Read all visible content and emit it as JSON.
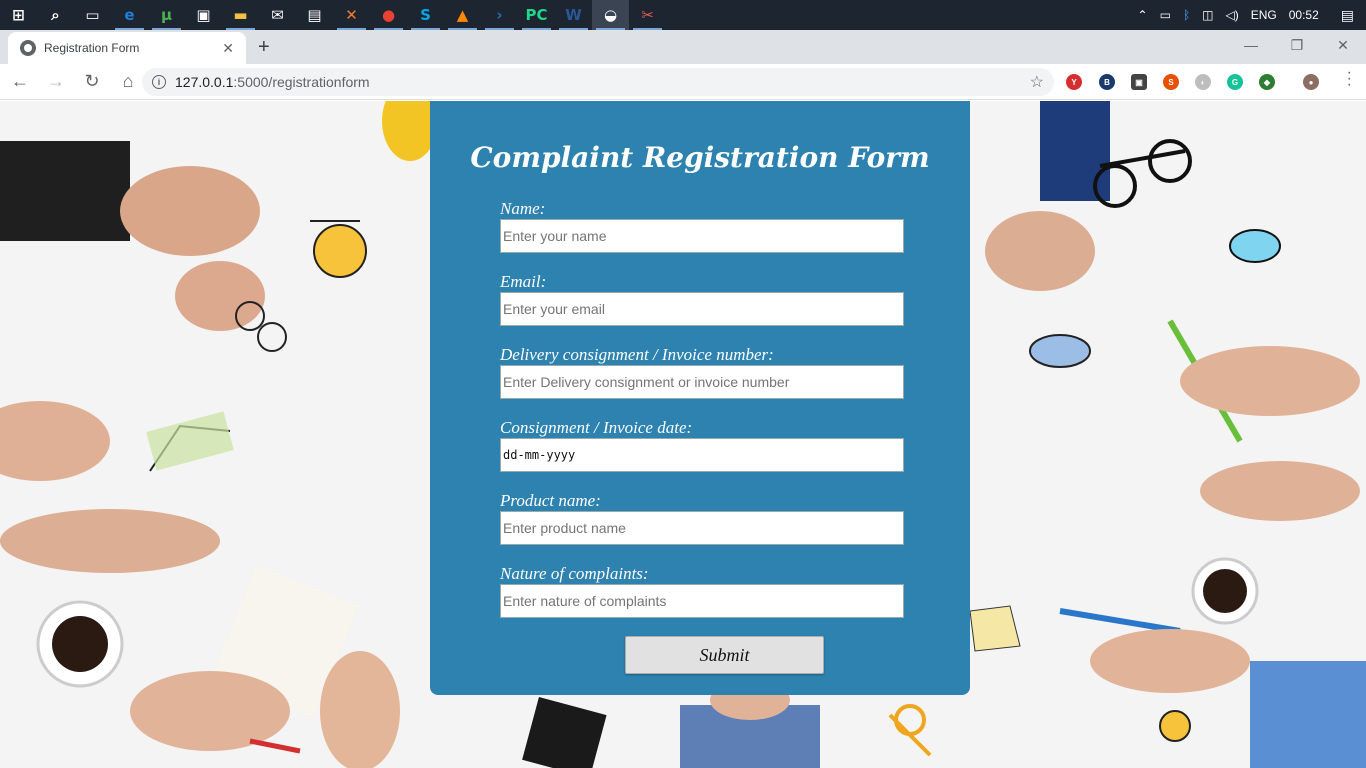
{
  "taskbar": {
    "apps": [
      {
        "name": "start-button",
        "glyph": "⊞",
        "color": "#ffffff"
      },
      {
        "name": "search-icon",
        "glyph": "⌕",
        "color": "#ffffff"
      },
      {
        "name": "task-view-icon",
        "glyph": "▭",
        "color": "#ffffff"
      },
      {
        "name": "edge-icon",
        "glyph": "e",
        "color": "#1e7ed8"
      },
      {
        "name": "utorrent-icon",
        "glyph": "µ",
        "color": "#4caf50"
      },
      {
        "name": "store-icon",
        "glyph": "▣",
        "color": "#ffffff"
      },
      {
        "name": "file-explorer-icon",
        "glyph": "▬",
        "color": "#f2c043"
      },
      {
        "name": "mail-icon",
        "glyph": "✉",
        "color": "#ffffff"
      },
      {
        "name": "notepad-icon",
        "glyph": "▤",
        "color": "#ffffff"
      },
      {
        "name": "xampp-icon",
        "glyph": "✕",
        "color": "#f57c2b"
      },
      {
        "name": "chrome-icon",
        "glyph": "●",
        "color": "#e94235"
      },
      {
        "name": "skype-icon",
        "glyph": "S",
        "color": "#00a6ed"
      },
      {
        "name": "vlc-icon",
        "glyph": "▲",
        "color": "#ff8800"
      },
      {
        "name": "powershell-icon",
        "glyph": "›",
        "color": "#2671be"
      },
      {
        "name": "pycharm-icon",
        "glyph": "PC",
        "color": "#21d789"
      },
      {
        "name": "word-icon",
        "glyph": "W",
        "color": "#2b579a"
      },
      {
        "name": "photos-icon",
        "glyph": "◒",
        "color": "#ffffff"
      },
      {
        "name": "snip-icon",
        "glyph": "✂",
        "color": "#e35b5b"
      }
    ],
    "language": "ENG",
    "clock": "00:52"
  },
  "browser": {
    "tab_title": "Registration Form",
    "tab_close": "✕",
    "new_tab": "+",
    "url_host": "127.0.0.1",
    "url_path": ":5000/registrationform",
    "minimize": "—",
    "restore": "❐",
    "close": "✕"
  },
  "form": {
    "title": "Complaint Registration Form",
    "fields": [
      {
        "label": "Name:",
        "placeholder": "Enter your name"
      },
      {
        "label": "Email:",
        "placeholder": "Enter your email"
      },
      {
        "label": "Delivery consignment / Invoice number:",
        "placeholder": "Enter Delivery consignment or invoice number"
      },
      {
        "label": "Consignment / Invoice date:",
        "placeholder": "dd-mm-yyyy"
      },
      {
        "label": "Product name:",
        "placeholder": "Enter product name"
      },
      {
        "label": "Nature of complaints:",
        "placeholder": "Enter nature of complaints"
      }
    ],
    "submit_label": "Submit"
  },
  "colors": {
    "form_background": "#2d82b0",
    "taskbar": "#1c2530"
  }
}
